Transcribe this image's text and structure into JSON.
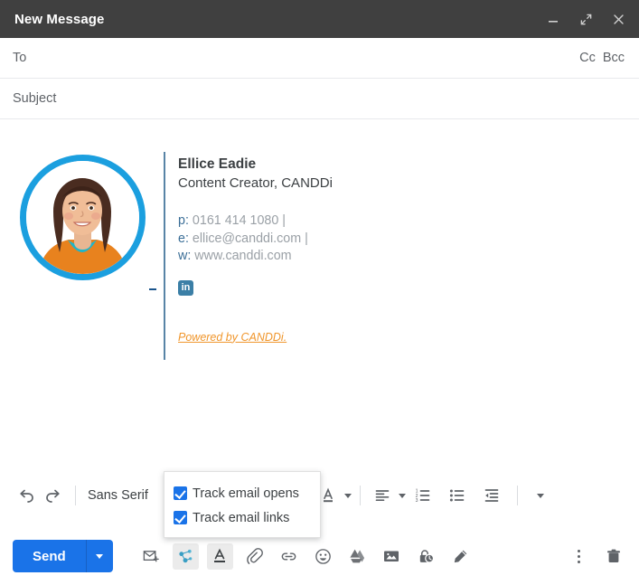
{
  "window": {
    "title": "New Message",
    "controls": [
      {
        "name": "minimize",
        "icon": "minimize-icon"
      },
      {
        "name": "expand",
        "icon": "expand-icon"
      },
      {
        "name": "close",
        "icon": "close-icon"
      }
    ]
  },
  "fields": {
    "to_placeholder": "To",
    "cc_label": "Cc",
    "bcc_label": "Bcc",
    "subject_placeholder": "Subject"
  },
  "signature": {
    "name": "Ellice Eadie",
    "role": "Content Creator, CANDDi",
    "phone_key": "p:",
    "phone_value": "0161 414 1080 |",
    "email_key": "e:",
    "email_value": "ellice@canddi.com |",
    "web_key": "w:",
    "web_value": "www.canddi.com",
    "linkedin_label": "in",
    "powered_by": "Powered by CANDDi.",
    "avatar_alt": "avatar",
    "accent_ring_color": "#1b9fdf",
    "link_color": "#f0962c",
    "key_color": "#3b6e97",
    "value_color": "#9aa0a6"
  },
  "format_toolbar": {
    "undo": "undo-icon",
    "redo": "redo-icon",
    "font_name": "Sans Serif",
    "italic": "italic-icon",
    "underline": "underline-icon",
    "text_color": "text-color-icon",
    "align": "align-left-icon",
    "numbered_list": "numbered-list-icon",
    "bulleted_list": "bulleted-list-icon",
    "indent_less": "indent-decrease-icon",
    "more": "more-formatting-icon"
  },
  "track_popup": {
    "items": [
      {
        "label": "Track email opens",
        "checked": true
      },
      {
        "label": "Track email links",
        "checked": true
      }
    ]
  },
  "action_bar": {
    "send_label": "Send",
    "send_options": "send-options-icon",
    "buttons": [
      {
        "name": "insert-template-icon",
        "active": false
      },
      {
        "name": "canddi-track-icon",
        "active": true
      },
      {
        "name": "formatting-options-icon",
        "active": true
      },
      {
        "name": "attach-file-icon",
        "active": false
      },
      {
        "name": "insert-link-icon",
        "active": false
      },
      {
        "name": "insert-emoji-icon",
        "active": false
      },
      {
        "name": "insert-drive-icon",
        "active": false
      },
      {
        "name": "insert-photo-icon",
        "active": false
      },
      {
        "name": "confidential-mode-icon",
        "active": false
      },
      {
        "name": "insert-signature-icon",
        "active": false
      }
    ],
    "more_options": "more-options-icon",
    "discard": "discard-draft-icon",
    "accent_color": "#1a73e8"
  }
}
